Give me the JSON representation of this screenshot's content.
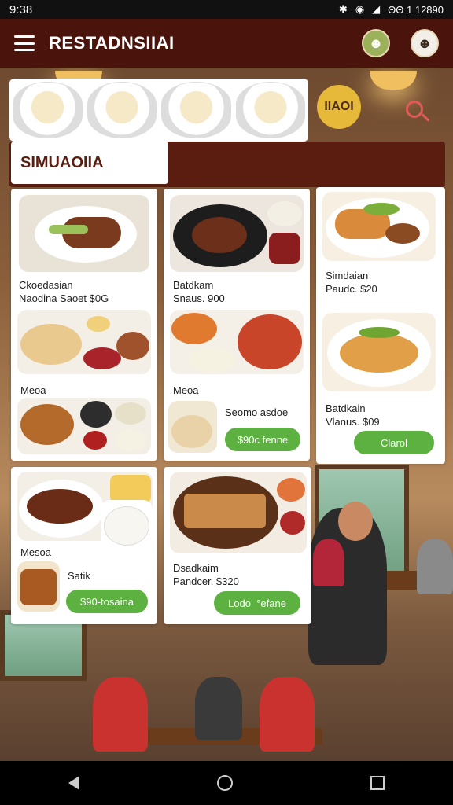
{
  "status_bar": {
    "time": "9:38",
    "icons_text": "ΘΘ 1 12890"
  },
  "app_bar": {
    "title": "RESTADNSIIAI"
  },
  "promo": {
    "badge_text": "IIAOI"
  },
  "section": {
    "title": "SIMUAOIIA"
  },
  "cards": {
    "c1": {
      "line1": "Ckoedasian",
      "line2": "Naodina Saoet $0G"
    },
    "c2": {
      "line1": "Batdkam",
      "line2": "Snaus. 900"
    },
    "c3": {
      "line1": "Simdaian",
      "line2": "Paudc. $20"
    },
    "c4": {
      "label": "Meoa"
    },
    "c5": {
      "label": "Meoa",
      "text": "Seomo asdoe",
      "button": "$90c fenne"
    },
    "c6": {
      "line1": "Batdkain",
      "line2": "Vlanus. $09",
      "button": "Clarol"
    },
    "c7": {
      "label": "Mesoa",
      "text": "Satik",
      "button": "$90-tosaina"
    },
    "c8": {
      "line1": "Dsadkaim",
      "line2": "Pandcer. $320",
      "button": "Lodo  °efane"
    }
  }
}
